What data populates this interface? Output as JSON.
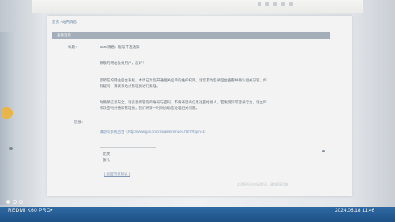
{
  "breadcrumb": {
    "home": "首页",
    "separator": " › ",
    "current": "站内消息"
  },
  "panel": {
    "title": "查看消息"
  },
  "message": {
    "subject_label": "标题：",
    "subject_value": "CMS消息：账号开通通知",
    "greeting": "尊敬的网站会员用户，您好！",
    "paragraph1": "您所在的网站后台系统，本周已为您开通相关栏目的维护权限，请您及时登录后台查看并确认相关内容。如有疑问，请联系站点管理员进行处理。",
    "paragraph2": "为确保信息安全，请妥善保管您的账号与密码，不要将登录信息透露给他人。若发现异常登录行为，请立即修改密码并通知管理员，我们将第一时间协助您处理相关问题。",
    "link_label": "链接：",
    "link_text": "请访问系统后台（http://www.gov.cn/cms/admin/index.html?login=1）",
    "signature1": "此致",
    "signature2": "敬礼",
    "reply_link": "[ 返回消息列表 ]",
    "footer_note": "本消息由系统自动发送，请勿直接回复"
  },
  "watermark": {
    "device": "REDMI K60 PRO•",
    "datetime": "2024.05.18  11:46"
  }
}
